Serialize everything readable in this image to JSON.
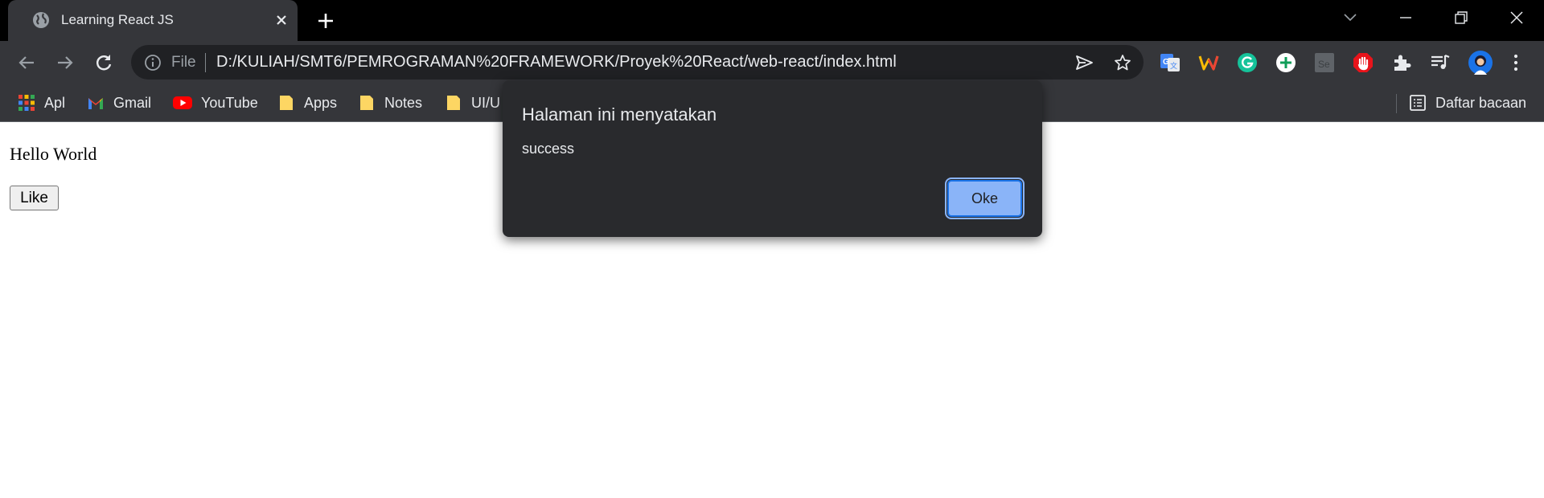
{
  "tab": {
    "title": "Learning React JS",
    "favicon": "globe-icon"
  },
  "address_bar": {
    "scheme_label": "File",
    "url": "D:/KULIAH/SMT6/PEMROGRAMAN%20FRAMEWORK/Proyek%20React/web-react/index.html"
  },
  "bookmarks": {
    "items": [
      {
        "label": "Apl",
        "icon": "apps-grid-icon"
      },
      {
        "label": "Gmail",
        "icon": "gmail-icon"
      },
      {
        "label": "YouTube",
        "icon": "youtube-icon"
      },
      {
        "label": "Apps",
        "icon": "folder-icon"
      },
      {
        "label": "Notes",
        "icon": "folder-icon"
      },
      {
        "label": "UI/U",
        "icon": "folder-icon"
      }
    ],
    "reading_list": "Daftar bacaan"
  },
  "page": {
    "heading": "Hello World",
    "like_button": "Like"
  },
  "dialog": {
    "title": "Halaman ini menyatakan",
    "message": "success",
    "ok_button": "Oke"
  },
  "colors": {
    "tab_bg": "#35363a",
    "toolbar_bg": "#35363a",
    "dialog_bg": "#292a2d",
    "ok_button_bg": "#8ab4f8"
  }
}
